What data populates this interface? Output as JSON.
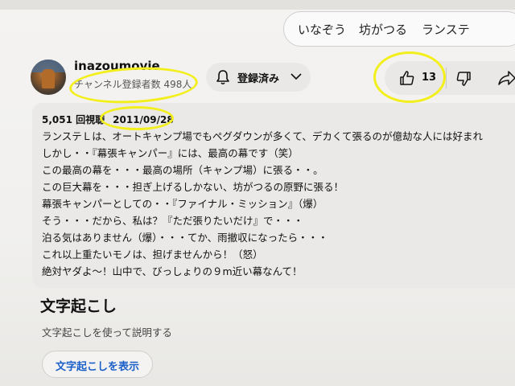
{
  "search_suggestions": [
    "いなぞう",
    "坊がつる",
    "ランステ"
  ],
  "channel": {
    "name": "inazoumovie",
    "subscribers": "チャンネル登録者数 498人",
    "subscribe_label": "登録済み"
  },
  "actions": {
    "like_count": "13"
  },
  "description": {
    "views": "5,051 回視聴",
    "date": "2011/09/28",
    "lines": [
      "ランステＬは、オートキャンプ場でもペグダウンが多くて、デカくて張るのが億劫な人には好まれ",
      "しかし・・『幕張キャンパー』には、最高の幕です（笑）",
      "この最高の幕を・・・最高の場所（キャンプ場）に張る・・。",
      "この巨大幕を・・・担ぎ上げるしかない、坊がつるの原野に張る！",
      "幕張キャンパーとしての・・『ファイナル・ミッション』（爆）",
      "そう・・・だから、私は？『ただ張りたいだけ』で・・・",
      "泊る気はありません（爆）・・・てか、雨撤収になったら・・・",
      "これ以上重たいモノは、担げませんから！（怒）",
      "絶対ヤダよ～！山中で、びっしょりの９m近い幕なんて！"
    ]
  },
  "transcript": {
    "heading": "文字起こし",
    "description": "文字起こしを使って説明する",
    "button": "文字起こしを表示"
  },
  "colors": {
    "highlight_circle": "#f3ef1c",
    "link_blue": "#1a5fc9",
    "pill_bg": "#e9e8e6"
  },
  "icons": [
    "bell-icon",
    "chevron-down-icon",
    "thumbs-up-icon",
    "thumbs-down-icon",
    "share-icon"
  ]
}
